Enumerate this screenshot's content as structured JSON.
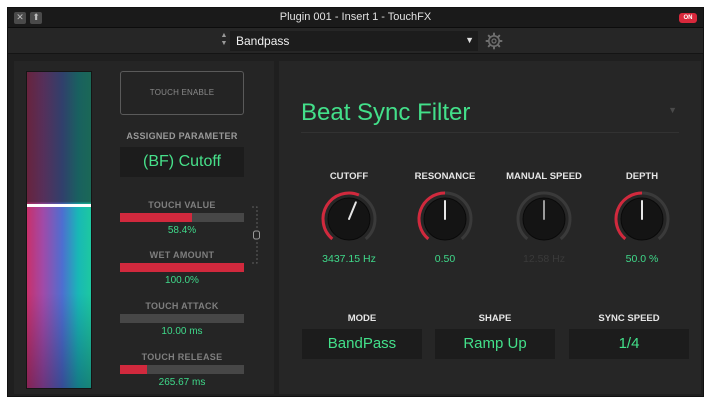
{
  "titlebar": {
    "title": "Plugin 001 - Insert 1 - TouchFX",
    "close_glyph": "✕",
    "up_glyph": "⬆",
    "on_label": "ON"
  },
  "preset": {
    "name": "Bandpass",
    "arrows_up": "▲",
    "arrows_down": "▼",
    "caret": "▼",
    "gear_icon": "gear-icon"
  },
  "touch": {
    "enable_label": "TOUCH ENABLE",
    "assigned_label": "ASSIGNED PARAMETER",
    "assigned_value": "(BF) Cutoff",
    "position_fraction": 0.42,
    "params": [
      {
        "label": "TOUCH VALUE",
        "value": "58.4%",
        "fill": 0.584
      },
      {
        "label": "WET AMOUNT",
        "value": "100.0%",
        "fill": 1.0
      },
      {
        "label": "TOUCH ATTACK",
        "value": "10.00 ms",
        "fill": 0.0
      },
      {
        "label": "TOUCH RELEASE",
        "value": "265.67 ms",
        "fill": 0.22
      }
    ]
  },
  "effect": {
    "title": "Beat Sync Filter",
    "caret": "▼",
    "knobs": [
      {
        "label": "CUTOFF",
        "value": "3437.15 Hz",
        "level": 0.58,
        "active": true
      },
      {
        "label": "RESONANCE",
        "value": "0.50",
        "level": 0.5,
        "active": true
      },
      {
        "label": "MANUAL SPEED",
        "value": "12.58 Hz",
        "level": 0.5,
        "active": false
      },
      {
        "label": "DEPTH",
        "value": "50.0 %",
        "level": 0.5,
        "active": true
      }
    ],
    "options": [
      {
        "label": "MODE",
        "value": "BandPass"
      },
      {
        "label": "SHAPE",
        "value": "Ramp Up"
      },
      {
        "label": "SYNC SPEED",
        "value": "1/4"
      }
    ]
  },
  "colors": {
    "accent": "#43e08a",
    "bar_red": "#d1293d",
    "background": "#1f1f1f"
  }
}
